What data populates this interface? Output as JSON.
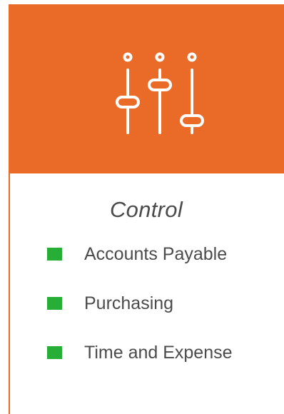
{
  "icon": "sliders-icon",
  "colors": {
    "header_bg": "#ea6a27",
    "bullet": "#27ae36",
    "text": "#4b4b4b",
    "icon_stroke": "#ffffff"
  },
  "title": "Control",
  "items": [
    {
      "label": "Accounts Payable"
    },
    {
      "label": "Purchasing"
    },
    {
      "label": "Time and Expense"
    }
  ]
}
